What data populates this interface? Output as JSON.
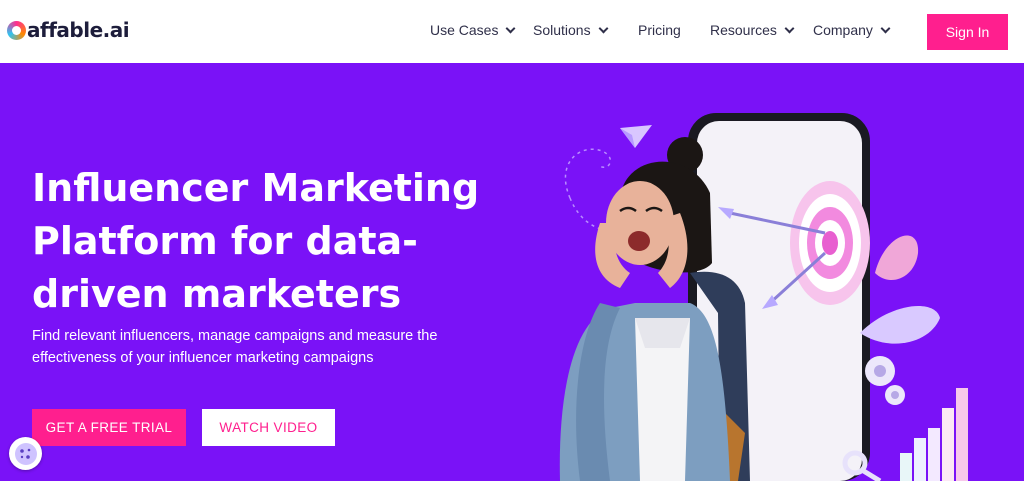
{
  "brand": {
    "name": "affable.ai"
  },
  "nav": {
    "use_cases": "Use Cases",
    "solutions": "Solutions",
    "pricing": "Pricing",
    "resources": "Resources",
    "company": "Company",
    "sign_in": "Sign In"
  },
  "hero": {
    "title": "Influencer Marketing Platform for data-driven marketers",
    "subtitle": "Find relevant influencers, manage campaigns and measure the effectiveness of your influencer marketing campaigns",
    "cta_primary": "GET A FREE TRIAL",
    "cta_secondary": "WATCH VIDEO"
  },
  "icons": {
    "chevron": "chevron-down-icon",
    "cookie": "cookie-icon",
    "illustration": "hero-illustration"
  },
  "colors": {
    "hero_bg": "#7a12f7",
    "accent": "#ff1f8e",
    "nav_text": "#30304a",
    "logo_text": "#1d1d3b"
  }
}
